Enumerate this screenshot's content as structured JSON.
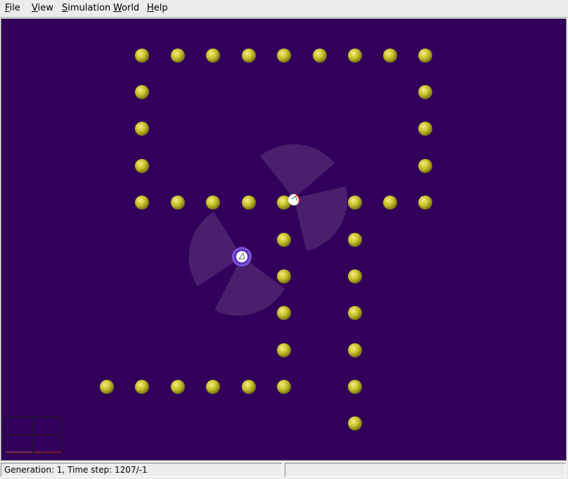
{
  "menubar": {
    "items": [
      {
        "mnemonic": "F",
        "rest": "ile"
      },
      {
        "mnemonic": "V",
        "rest": "iew"
      },
      {
        "mnemonic": "S",
        "rest": "imulation"
      },
      {
        "mnemonic": "W",
        "rest": "orld"
      },
      {
        "mnemonic": "H",
        "rest": "elp"
      }
    ]
  },
  "world": {
    "background_color": "#32005a",
    "food_color": "#c8c028",
    "agents": [
      {
        "name": "agent-robot-white",
        "ring_color": "#ffffff"
      },
      {
        "name": "agent-robot-purple",
        "ring_color": "#7a52dc"
      }
    ],
    "minimap": {
      "border_color": "#1a1a1a",
      "accent_colors": [
        "#d04060",
        "#d02828"
      ]
    }
  },
  "status": {
    "left_text": "Generation: 1, Time step: 1207/-1",
    "right_text": ""
  }
}
